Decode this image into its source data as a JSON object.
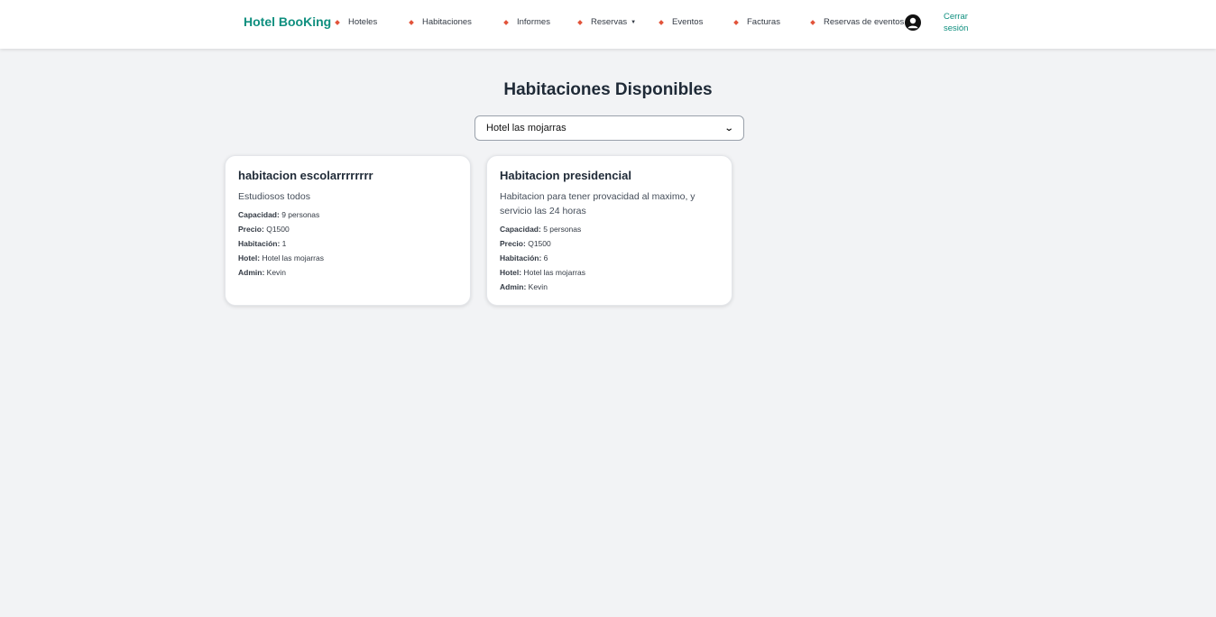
{
  "navbar": {
    "brand": "Hotel BooKing",
    "items": [
      {
        "label": "Hoteles"
      },
      {
        "label": "Habitaciones"
      },
      {
        "label": "Informes"
      },
      {
        "label": "Reservas"
      },
      {
        "label": "Eventos"
      },
      {
        "label": "Facturas"
      },
      {
        "label": "Reservas de eventos"
      }
    ],
    "logout_label": "Cerrar sesión",
    "colors": {
      "brand": "#0f8f7f",
      "bullet": "#e2533a"
    }
  },
  "main": {
    "title": "Habitaciones Disponibles",
    "hotel_select": {
      "selected": "Hotel las mojarras"
    },
    "field_labels": {
      "capacity": "Capacidad:",
      "price": "Precio:",
      "room": "Habitación:",
      "hotel": "Hotel:",
      "admin": "Admin:"
    },
    "rooms": [
      {
        "name": "habitacion escolarrrrrrrr",
        "description": "Estudiosos todos",
        "capacity": "9 personas",
        "price": "Q1500",
        "room": "1",
        "hotel": "Hotel las mojarras",
        "admin": "Kevin"
      },
      {
        "name": "Habitacion presidencial",
        "description": "Habitacion para tener provacidad al maximo, y servicio las 24 horas",
        "capacity": "5 personas",
        "price": "Q1500",
        "room": "6",
        "hotel": "Hotel las mojarras",
        "admin": "Kevin"
      }
    ]
  }
}
